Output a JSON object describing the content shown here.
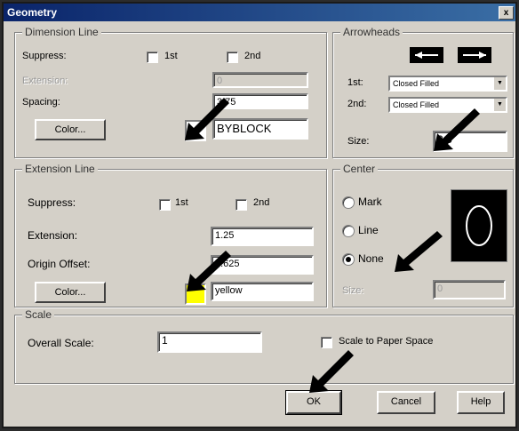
{
  "window": {
    "title": "Geometry",
    "close_glyph": "x"
  },
  "dimension_line": {
    "group_label": "Dimension Line",
    "suppress_label": "Suppress:",
    "first_label": "1st",
    "second_label": "2nd",
    "extension_label": "Extension:",
    "extension_value": "0",
    "spacing_label": "Spacing:",
    "spacing_value": "3.75",
    "color_button": "Color...",
    "color_value": "BYBLOCK",
    "swatch_color": "#ffffff"
  },
  "extension_line": {
    "group_label": "Extension Line",
    "suppress_label": "Suppress:",
    "first_label": "1st",
    "second_label": "2nd",
    "extension_label": "Extension:",
    "extension_value": "1.25",
    "origin_offset_label": "Origin Offset:",
    "origin_offset_value": "0.625",
    "color_button": "Color...",
    "color_value": "yellow",
    "swatch_color": "#ffff00"
  },
  "arrowheads": {
    "group_label": "Arrowheads",
    "first_label": "1st:",
    "first_value": "Closed Filled",
    "second_label": "2nd:",
    "second_value": "Closed Filled",
    "size_label": "Size:",
    "size_value": "2.5"
  },
  "center": {
    "group_label": "Center",
    "options": [
      "Mark",
      "Line",
      "None"
    ],
    "selected": "None",
    "size_label": "Size:",
    "size_value": "0"
  },
  "scale": {
    "group_label": "Scale",
    "overall_label": "Overall Scale:",
    "overall_value": "1",
    "paper_space_label": "Scale to Paper Space"
  },
  "buttons": {
    "ok": "OK",
    "cancel": "Cancel",
    "help": "Help"
  },
  "colors": {
    "title_bar": "#0a246a",
    "dialog_bg": "#d4d0c8",
    "pointer": "#000000"
  }
}
